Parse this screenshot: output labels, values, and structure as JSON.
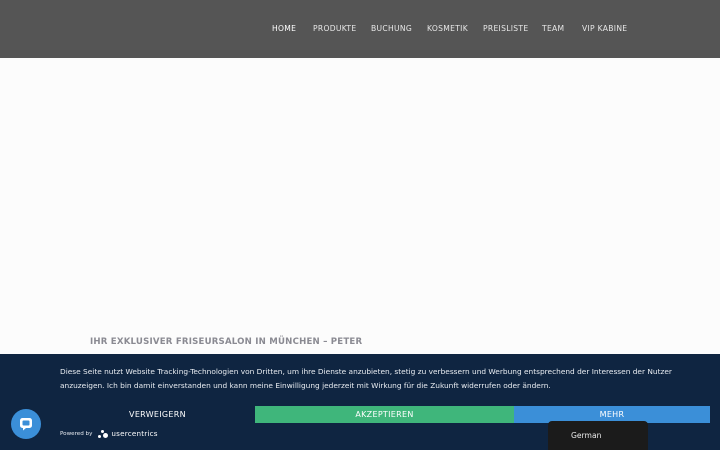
{
  "nav": {
    "items": [
      {
        "label": "HOME",
        "active": true
      },
      {
        "label": "PRODUKTE",
        "active": false
      },
      {
        "label": "BUCHUNG",
        "active": false
      },
      {
        "label": "KOSMETIK",
        "active": false
      },
      {
        "label": "PREISLISTE",
        "active": false
      },
      {
        "label": "TEAM",
        "active": false
      },
      {
        "label": "VIP KABINE",
        "active": false
      }
    ]
  },
  "hero": {
    "headline": "IHR EXKLUSIVER FRISEURSALON IN MÜNCHEN – PETER"
  },
  "consent": {
    "text": "Diese Seite nutzt Website Tracking-Technologien von Dritten, um ihre Dienste anzubieten, stetig zu verbessern und Werbung entsprechend der Interessen der Nutzer anzuzeigen. Ich bin damit einverstanden und kann meine Einwilligung jederzeit mit Wirkung für die Zukunft widerrufen oder ändern.",
    "deny_label": "VERWEIGERN",
    "accept_label": "AKZEPTIEREN",
    "more_label": "MEHR",
    "powered_by": "Powered by",
    "brand_name": "usercentrics"
  },
  "language": {
    "current": "German"
  },
  "icons": {
    "chat": "chat-bubble-icon",
    "brand_logo": "usercentrics-logo-icon"
  },
  "colors": {
    "header_bg": "#555555",
    "consent_bg": "#0f2541",
    "accept": "#3fb67b",
    "more": "#3b8fd8",
    "chat": "#3b8fd8"
  }
}
